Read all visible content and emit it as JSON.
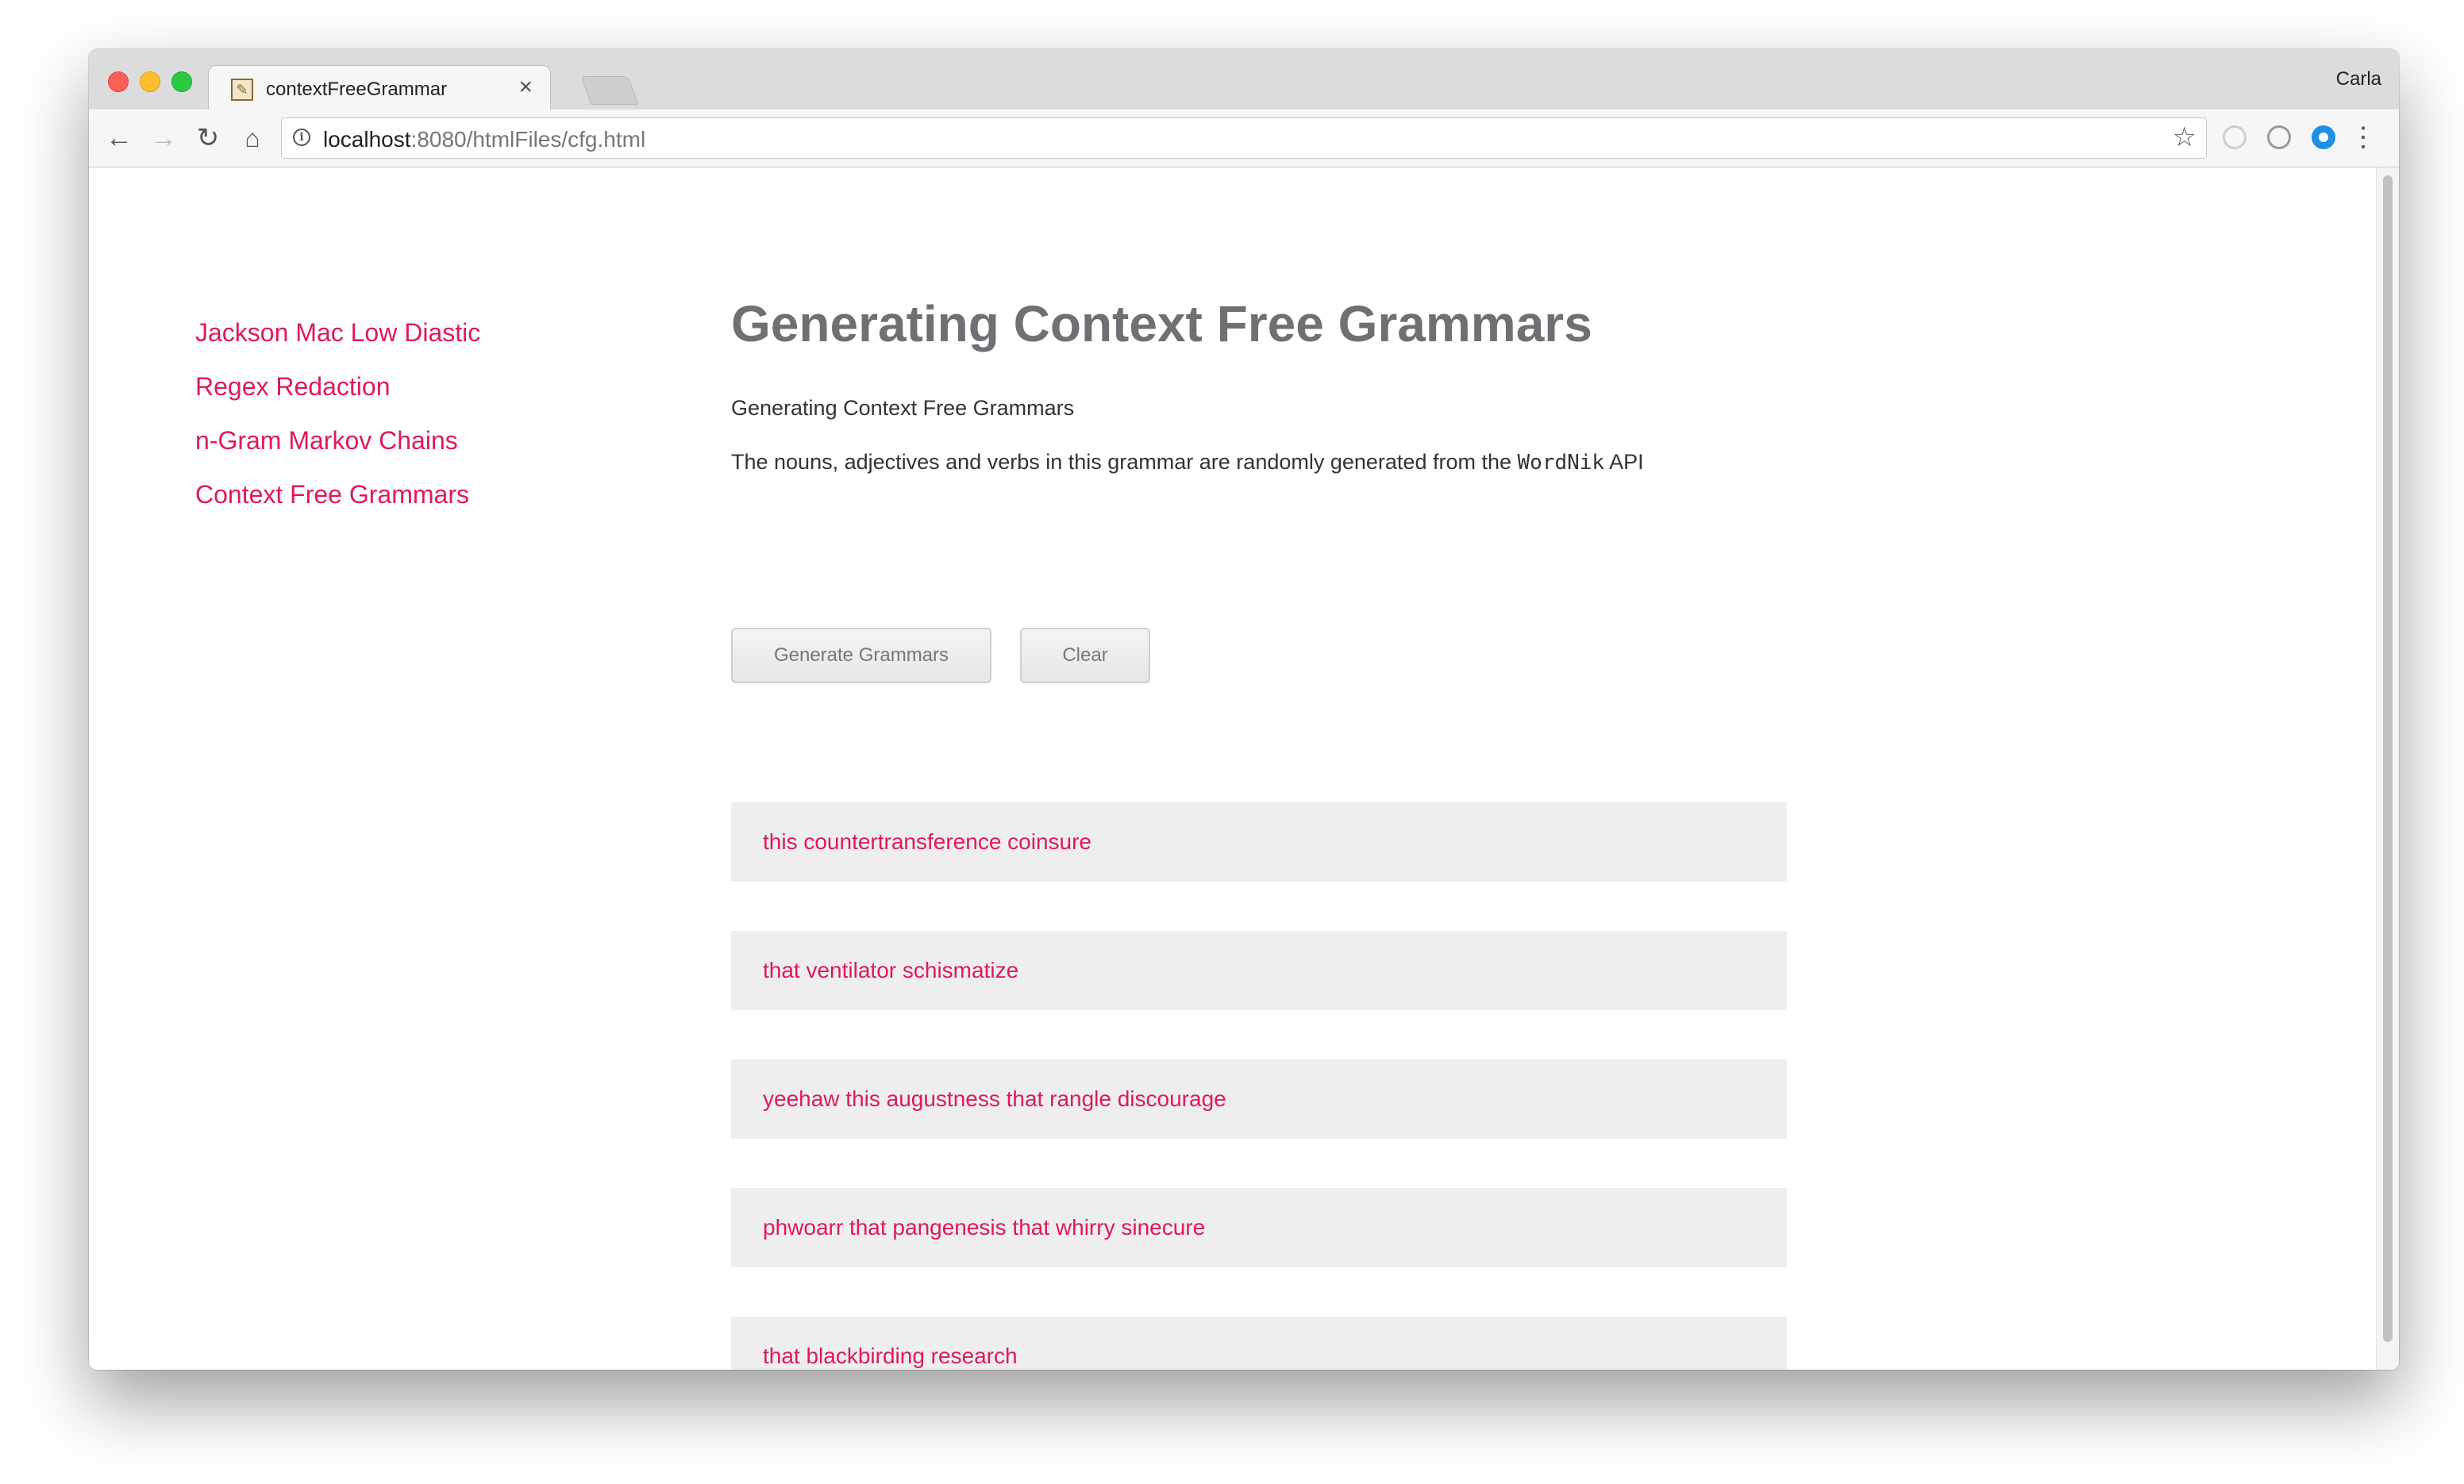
{
  "browser": {
    "tab_title": "contextFreeGrammar",
    "tab_close_glyph": "×",
    "profile_name": "Carla",
    "url_host": "localhost",
    "url_rest": ":8080/htmlFiles/cfg.html",
    "icons": {
      "back": "arrow-left-icon",
      "forward": "arrow-right-icon",
      "reload": "reload-icon",
      "home": "home-icon",
      "info": "info-icon",
      "bookmark": "star-icon",
      "menu": "kebab-menu-icon"
    }
  },
  "sidebar": {
    "items": [
      {
        "label": "Jackson Mac Low Diastic"
      },
      {
        "label": "Regex Redaction"
      },
      {
        "label": "n-Gram Markov Chains"
      },
      {
        "label": "Context Free Grammars"
      }
    ]
  },
  "main": {
    "title": "Generating Context Free Grammars",
    "subtitle": "Generating Context Free Grammars",
    "description_before": "The nouns, adjectives and verbs in this grammar are randomly generated from the",
    "description_code": "WordNik",
    "description_after": "API",
    "generate_label": "Generate Grammars",
    "clear_label": "Clear",
    "results": [
      "this countertransference coinsure",
      "that ventilator schismatize",
      "yeehaw this augustness that rangle discourage",
      "phwoarr that pangenesis that whirry sinecure",
      "that blackbirding research"
    ]
  },
  "colors": {
    "link": "#e0195a",
    "title": "#707074",
    "result_bg": "#eeeeee"
  }
}
